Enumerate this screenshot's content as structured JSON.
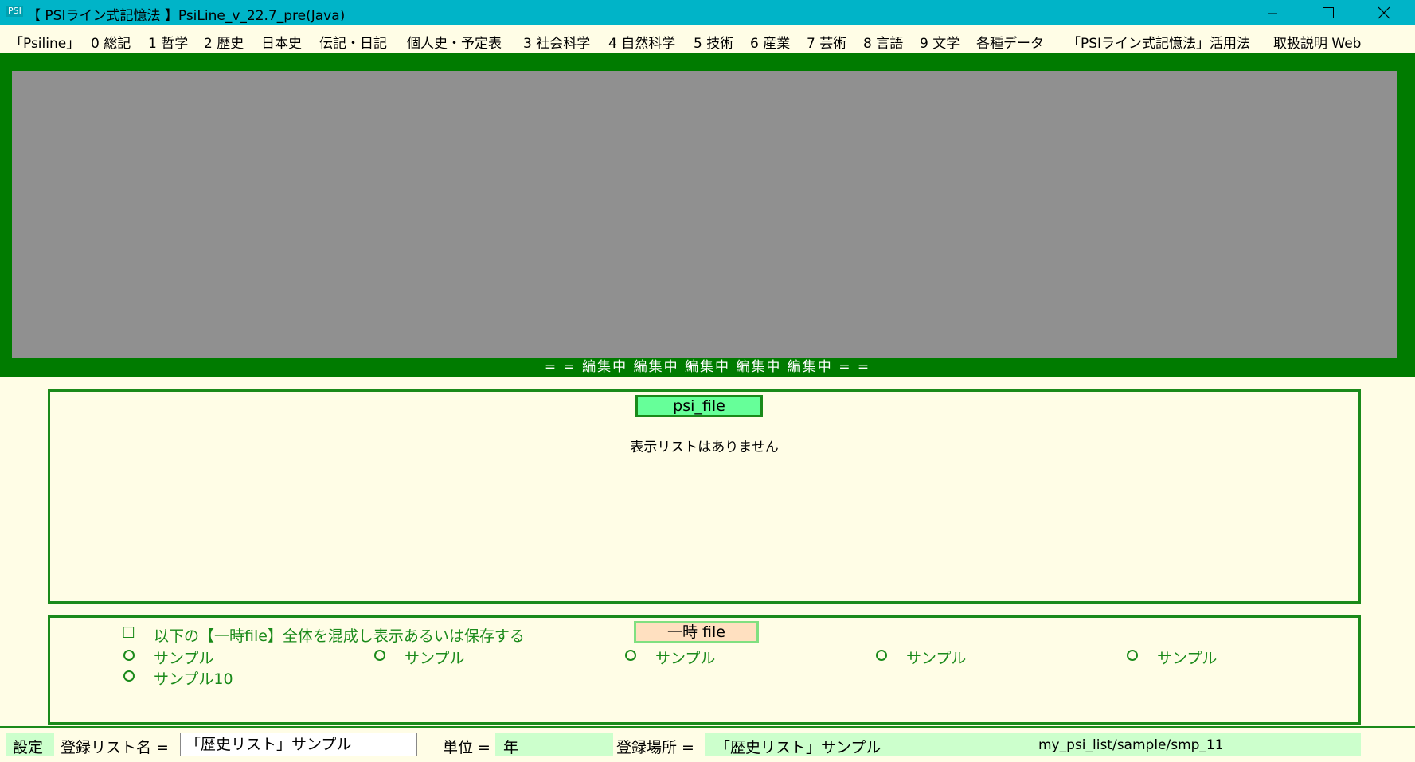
{
  "window": {
    "icon_label": "PSI",
    "title": "【 PSIライン式記憶法 】PsiLine_v_22.7_pre(Java)"
  },
  "menu": [
    "「Psiline」",
    "0 総記",
    "1 哲学",
    "2 歴史",
    "日本史",
    "伝記・日記",
    "個人史・予定表",
    "3 社会科学",
    "4 自然科学",
    "5 技術",
    "6 産業",
    "7 芸術",
    "8 言語",
    "9 文学",
    "各種データ",
    "「PSIライン式記憶法」活用法",
    "取扱説明 Web"
  ],
  "canvas": {
    "editing_label": "= = 編集中  編集中  編集中  編集中  編集中 = ="
  },
  "list_panel": {
    "psi_file_button": "psi_file",
    "empty_message": "表示リストはありません"
  },
  "temp_panel": {
    "checkbox_symbol": "☐",
    "checkbox_label": "以下の【一時file】全体を混成し表示あるいは保存する",
    "temp_file_button": "一時 file",
    "radio_items": [
      "サンプル",
      "サンプル",
      "サンプル",
      "サンプル",
      "サンプル",
      "サンプル10"
    ]
  },
  "status": {
    "settings": "設定",
    "list_name_label": "登録リスト名 =",
    "list_name_value": "「歴史リスト」サンプル",
    "unit_label": "単位 =",
    "unit_value": "年",
    "location_label": "登録場所 =",
    "location_value": "「歴史リスト」サンプル",
    "path": "my_psi_list/sample/smp_11"
  },
  "colors": {
    "titlebar": "#00b4c8",
    "band": "#007b00",
    "canvas": "#909090",
    "background": "#fffde6",
    "accent_green": "#1a8a1a"
  }
}
